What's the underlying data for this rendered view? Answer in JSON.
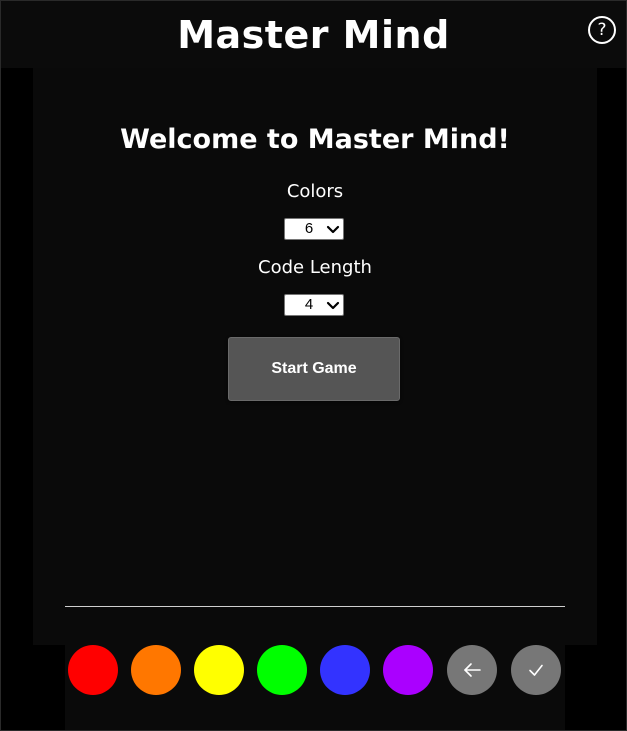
{
  "header": {
    "title": "Master Mind",
    "help_label": "?",
    "help_icon": "help-circle-icon"
  },
  "setup": {
    "welcome": "Welcome to Master Mind!",
    "colors_label": "Colors",
    "colors_value": "6",
    "code_length_label": "Code Length",
    "code_length_value": "4",
    "start_label": "Start Game"
  },
  "palette": {
    "pegs": [
      {
        "name": "red",
        "color": "#ff0000"
      },
      {
        "name": "orange",
        "color": "#ff7700"
      },
      {
        "name": "yellow",
        "color": "#ffff00"
      },
      {
        "name": "green",
        "color": "#00ff00"
      },
      {
        "name": "blue",
        "color": "#3333ff"
      },
      {
        "name": "purple",
        "color": "#aa00ff"
      }
    ],
    "controls": [
      {
        "name": "backspace",
        "icon": "arrow-left-icon"
      },
      {
        "name": "submit",
        "icon": "check-icon"
      }
    ],
    "control_color": "#777777"
  },
  "theme": {
    "background": "#000000",
    "panel": "#0a0a0a",
    "button": "#555555",
    "text": "#ffffff"
  }
}
